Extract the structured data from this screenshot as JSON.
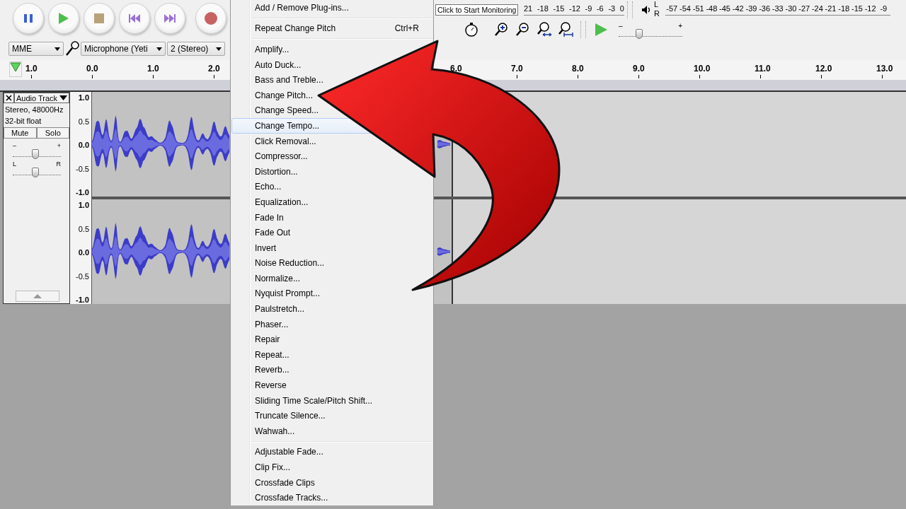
{
  "device_toolbar": {
    "host": "MME",
    "input_device": "Microphone (Yeti",
    "input_channels": "2 (Stereo)"
  },
  "meters": {
    "tooltip": "Click to Start Monitoring",
    "recording_ticks": [
      "21",
      "-18",
      "-15",
      "-12",
      "-9",
      "-6",
      "-3",
      "0"
    ],
    "playback_channels": [
      "L",
      "R"
    ],
    "playback_ticks": [
      "-57",
      "-54",
      "-51",
      "-48",
      "-45",
      "-42",
      "-39",
      "-36",
      "-33",
      "-30",
      "-27",
      "-24",
      "-21",
      "-18",
      "-15",
      "-12",
      "-9"
    ]
  },
  "play_at_speed": {
    "min_label": "–",
    "max_label": "+",
    "level": 0.32
  },
  "ruler": {
    "left_labels": [
      "1.0",
      "0.0",
      "1.0",
      "2.0"
    ],
    "right_labels": [
      "6.0",
      "7.0",
      "8.0",
      "9.0",
      "10.0",
      "11.0",
      "12.0",
      "13.0"
    ]
  },
  "track": {
    "name": "Audio Track",
    "info": [
      "Stereo, 48000Hz",
      "32-bit float"
    ],
    "buttons": [
      "Mute",
      "Solo"
    ],
    "gain": {
      "min_label": "–",
      "max_label": "+",
      "level": 0.47
    },
    "pan": {
      "min_label": "L",
      "max_label": "R",
      "level": 0.47
    },
    "channels": [
      {
        "scale": [
          {
            "label": "1.0",
            "major": true
          },
          {
            "label": "0.5",
            "major": false
          },
          {
            "label": "0.0",
            "major": true
          },
          {
            "label": "-0.5",
            "major": false
          },
          {
            "label": "-1.0",
            "major": true
          }
        ]
      },
      {
        "scale": [
          {
            "label": "1.0",
            "major": true
          },
          {
            "label": "0.5",
            "major": false
          },
          {
            "label": "0.0",
            "major": true
          },
          {
            "label": "-0.5",
            "major": false
          },
          {
            "label": "-1.0",
            "major": true
          }
        ]
      }
    ]
  },
  "menu": {
    "groups": [
      [
        {
          "label": "Add / Remove Plug-ins...",
          "selected": false
        }
      ],
      [
        {
          "label": "Repeat Change Pitch",
          "shortcut": "Ctrl+R",
          "selected": false
        }
      ],
      [
        {
          "label": "Amplify...",
          "selected": false
        },
        {
          "label": "Auto Duck...",
          "selected": false
        },
        {
          "label": "Bass and Treble...",
          "selected": false
        },
        {
          "label": "Change Pitch...",
          "selected": false
        },
        {
          "label": "Change Speed...",
          "selected": false
        },
        {
          "label": "Change Tempo...",
          "selected": true
        },
        {
          "label": "Click Removal...",
          "selected": false
        },
        {
          "label": "Compressor...",
          "selected": false
        },
        {
          "label": "Distortion...",
          "selected": false
        },
        {
          "label": "Echo...",
          "selected": false
        },
        {
          "label": "Equalization...",
          "selected": false
        },
        {
          "label": "Fade In",
          "selected": false
        },
        {
          "label": "Fade Out",
          "selected": false
        },
        {
          "label": "Invert",
          "selected": false
        },
        {
          "label": "Noise Reduction...",
          "selected": false
        },
        {
          "label": "Normalize...",
          "selected": false
        },
        {
          "label": "Nyquist Prompt...",
          "selected": false
        },
        {
          "label": "Paulstretch...",
          "selected": false
        },
        {
          "label": "Phaser...",
          "selected": false
        },
        {
          "label": "Repair",
          "selected": false
        },
        {
          "label": "Repeat...",
          "selected": false
        },
        {
          "label": "Reverb...",
          "selected": false
        },
        {
          "label": "Reverse",
          "selected": false
        },
        {
          "label": "Sliding Time Scale/Pitch Shift...",
          "selected": false
        },
        {
          "label": "Truncate Silence...",
          "selected": false
        },
        {
          "label": "Wahwah...",
          "selected": false
        }
      ],
      [
        {
          "label": "Adjustable Fade...",
          "selected": false
        },
        {
          "label": "Clip Fix...",
          "selected": false
        },
        {
          "label": "Crossfade Clips",
          "selected": false
        },
        {
          "label": "Crossfade Tracks...",
          "selected": false
        }
      ]
    ]
  },
  "annotation": {
    "kind": "curved-arrow"
  }
}
